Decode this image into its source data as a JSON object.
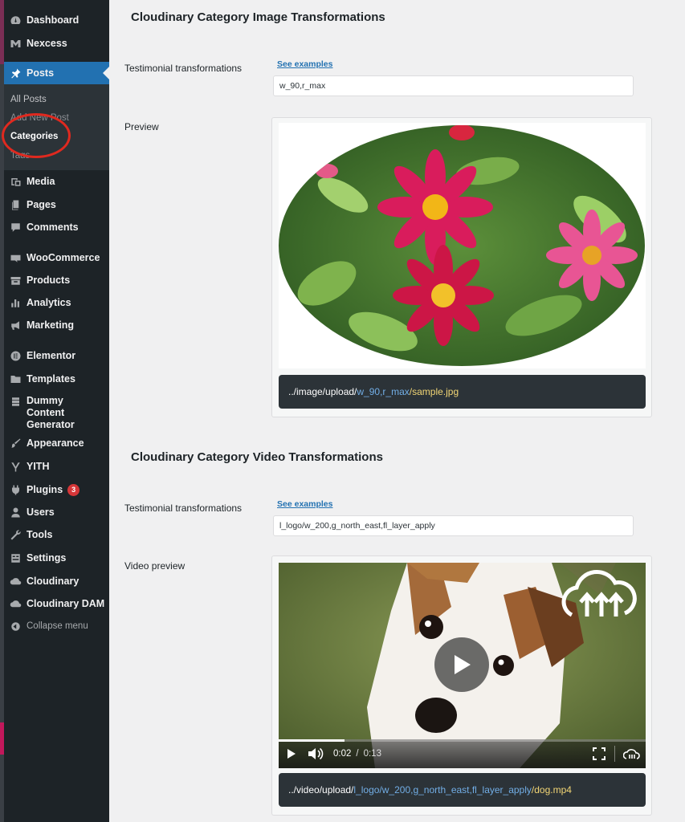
{
  "sidebar": {
    "items": [
      {
        "label": "Dashboard",
        "icon": "dashboard-icon"
      },
      {
        "label": "Nexcess",
        "icon": "nexcess-icon"
      },
      {
        "label": "Posts",
        "icon": "pin-icon"
      },
      {
        "label": "Media",
        "icon": "media-icon"
      },
      {
        "label": "Pages",
        "icon": "pages-icon"
      },
      {
        "label": "Comments",
        "icon": "comments-icon"
      },
      {
        "label": "WooCommerce",
        "icon": "woocommerce-icon"
      },
      {
        "label": "Products",
        "icon": "products-icon"
      },
      {
        "label": "Analytics",
        "icon": "analytics-icon"
      },
      {
        "label": "Marketing",
        "icon": "megaphone-icon"
      },
      {
        "label": "Elementor",
        "icon": "elementor-icon"
      },
      {
        "label": "Templates",
        "icon": "folder-icon"
      },
      {
        "label": "Dummy Content Generator",
        "icon": "database-icon"
      },
      {
        "label": "Appearance",
        "icon": "brush-icon"
      },
      {
        "label": "YITH",
        "icon": "yith-icon"
      },
      {
        "label": "Plugins",
        "icon": "plugins-icon",
        "badge": "3"
      },
      {
        "label": "Users",
        "icon": "users-icon"
      },
      {
        "label": "Tools",
        "icon": "wrench-icon"
      },
      {
        "label": "Settings",
        "icon": "settings-icon"
      },
      {
        "label": "Cloudinary",
        "icon": "cloudinary-icon"
      },
      {
        "label": "Cloudinary DAM",
        "icon": "cloudinary-dam-icon"
      },
      {
        "label": "Collapse menu",
        "icon": "collapse-icon"
      }
    ],
    "posts_submenu": [
      "All Posts",
      "Add New Post",
      "Categories",
      "Tags"
    ]
  },
  "image_section": {
    "title": "Cloudinary Category Image Transformations",
    "field_label": "Testimonial transformations",
    "link": "See examples",
    "value": "w_90,r_max",
    "preview_label": "Preview",
    "url_prefix": "../image/upload/",
    "url_transform": "w_90,r_max",
    "url_file": "/sample.jpg"
  },
  "video_section": {
    "title": "Cloudinary Category Video Transformations",
    "field_label": "Testimonial transformations",
    "link": "See examples",
    "value": "l_logo/w_200,g_north_east,fl_layer_apply",
    "preview_label": "Video preview",
    "time_current": "0:02",
    "time_separator": "/",
    "time_total": "0:13",
    "progress": 0.18,
    "url_prefix": "../video/upload/",
    "url_transform": "l_logo/w_200,g_north_east,fl_layer_apply",
    "url_file": "/dog.mp4"
  },
  "colors": {
    "sidebar_bg": "#1d2327",
    "active": "#2271b1",
    "link": "#2271b1",
    "badge": "#d63638",
    "url_blue": "#72aee6",
    "url_yellow": "#f2d675",
    "highlight_ring": "#e0291f"
  }
}
